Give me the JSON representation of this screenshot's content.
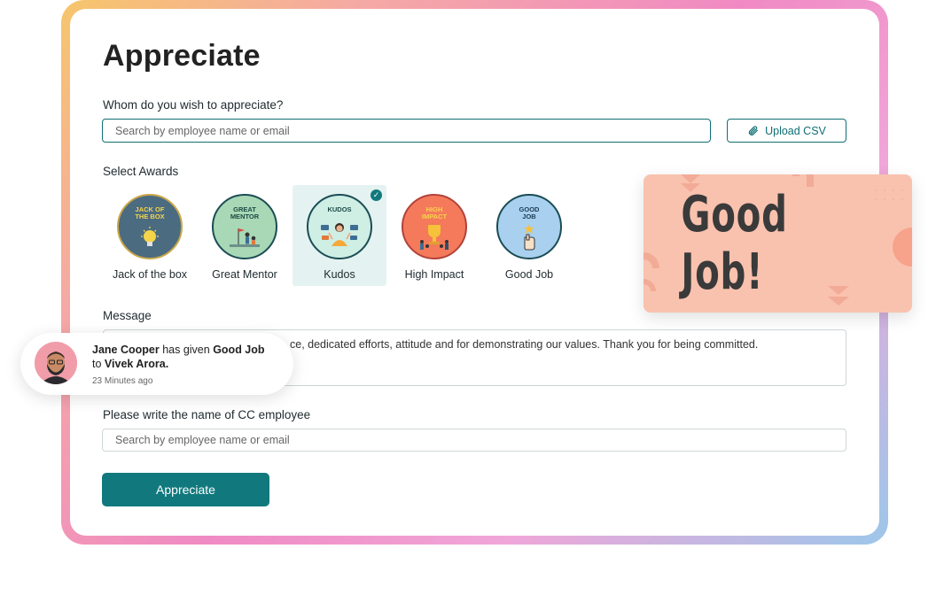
{
  "page": {
    "title": "Appreciate"
  },
  "recipient": {
    "label": "Whom do you wish to appreciate?",
    "placeholder": "Search by employee name or email",
    "upload_label": "Upload CSV"
  },
  "awards": {
    "label": "Select Awards",
    "items": [
      {
        "name": "Jack of the box",
        "badge_text": "Jack of the box",
        "bg": "#4b6b80",
        "text_color": "#f5d44a",
        "border": "#c9a64a",
        "selected": false
      },
      {
        "name": "Great Mentor",
        "badge_text": "Great Mentor",
        "bg": "#a8d8b5",
        "text_color": "#1d4a44",
        "border": "#1a4d55",
        "selected": false
      },
      {
        "name": "Kudos",
        "badge_text": "Kudos",
        "bg": "#cfeee4",
        "text_color": "#1d4a44",
        "border": "#1a4d55",
        "selected": true
      },
      {
        "name": "High Impact",
        "badge_text": "High Impact",
        "bg": "#f47a5b",
        "text_color": "#f7d44a",
        "border": "#b2423a",
        "selected": false
      },
      {
        "name": "Good Job",
        "badge_text": "Good Job",
        "bg": "#a9d0ee",
        "text_color": "#1d3d55",
        "border": "#1a4d55",
        "selected": false
      }
    ]
  },
  "message": {
    "label": "Message",
    "value": "ce, dedicated efforts, attitude and for demonstrating our values. Thank you for being committed."
  },
  "cc": {
    "label": "Please write the name of CC employee",
    "placeholder": "Search by employee name or email"
  },
  "submit_label": "Appreciate",
  "card_preview": {
    "text": "Good Job!"
  },
  "notification": {
    "giver": "Jane Cooper",
    "verb": "has given",
    "award": "Good Job",
    "to": "to",
    "receiver": "Vivek Arora.",
    "time": "23 Minutes ago"
  },
  "colors": {
    "primary": "#11797d",
    "preview_bg": "#f9c2ae"
  }
}
